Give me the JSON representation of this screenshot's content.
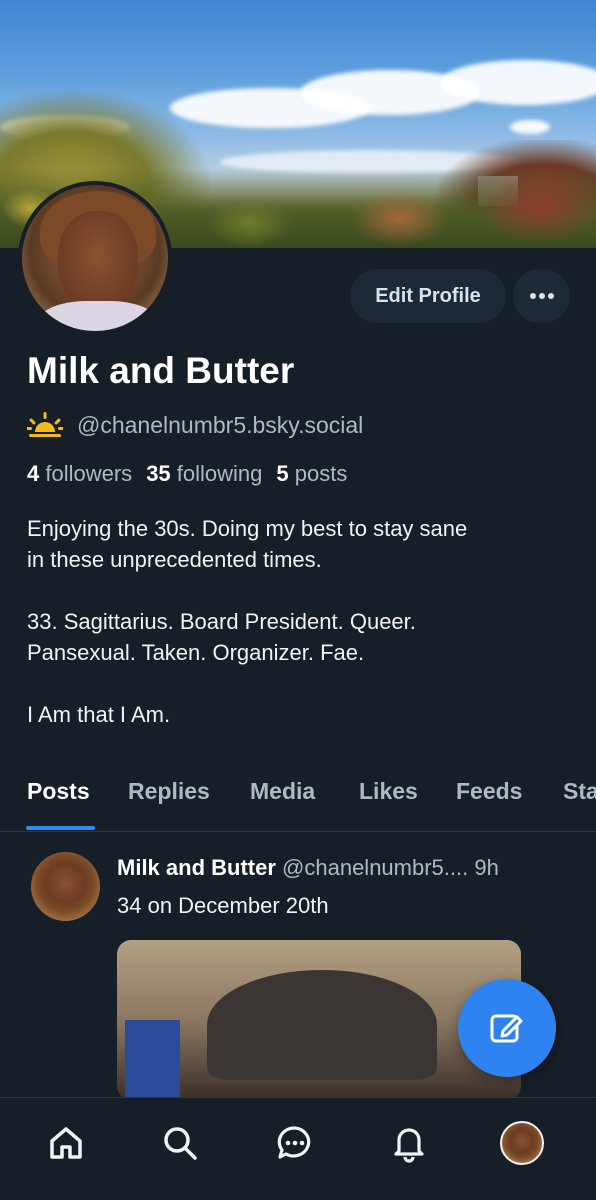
{
  "profile": {
    "display_name": "Milk and Butter",
    "handle": "@chanelnumbr5.bsky.social",
    "handle_icon": "sunrise-emoji",
    "stats": {
      "followers_count": "4",
      "followers_label": "followers",
      "following_count": "35",
      "following_label": "following",
      "posts_count": "5",
      "posts_label": "posts"
    },
    "bio": [
      "Enjoying the 30s. Doing my best to stay sane",
      "in these unprecedented times.",
      "",
      "33. Sagittarius. Board President. Queer.",
      "Pansexual. Taken. Organizer. Fae.",
      "",
      "I Am that I Am."
    ]
  },
  "actions": {
    "edit_profile": "Edit Profile",
    "more_icon": "ellipsis-icon"
  },
  "tabs": [
    {
      "label": "Posts",
      "active": true
    },
    {
      "label": "Replies",
      "active": false
    },
    {
      "label": "Media",
      "active": false
    },
    {
      "label": "Likes",
      "active": false
    },
    {
      "label": "Feeds",
      "active": false
    },
    {
      "label": "Sta",
      "active": false
    }
  ],
  "post": {
    "author": "Milk and Butter",
    "handle": "@chanelnumbr5....",
    "time": "9h",
    "text": "34 on December 20th"
  },
  "bottom_nav": [
    "home-icon",
    "search-icon",
    "chat-icon",
    "bell-icon",
    "profile-avatar"
  ],
  "colors": {
    "background": "#161e27",
    "accent": "#2f83f0",
    "muted_text": "#aeb9c6",
    "button_bg": "#1e2936"
  }
}
